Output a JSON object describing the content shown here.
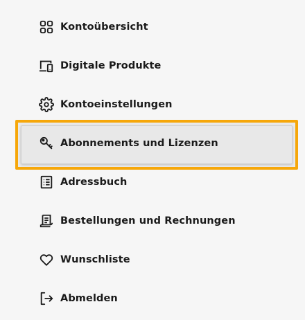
{
  "menu": {
    "items": [
      {
        "label": "Kontoübersicht",
        "icon": "grid-icon"
      },
      {
        "label": "Digitale Produkte",
        "icon": "devices-icon"
      },
      {
        "label": "Kontoeinstellungen",
        "icon": "gear-icon"
      },
      {
        "label": "Abonnements und Lizenzen",
        "icon": "key-icon",
        "selected": true
      },
      {
        "label": "Adressbuch",
        "icon": "address-book-icon"
      },
      {
        "label": "Bestellungen und Rechnungen",
        "icon": "receipt-icon"
      },
      {
        "label": "Wunschliste",
        "icon": "heart-icon"
      },
      {
        "label": "Abmelden",
        "icon": "logout-icon"
      }
    ]
  },
  "colors": {
    "background": "#f6f6f6",
    "text": "#1a1a1a",
    "focus_ring": "#f6a70a",
    "selected_bg": "#e8e8e8"
  }
}
